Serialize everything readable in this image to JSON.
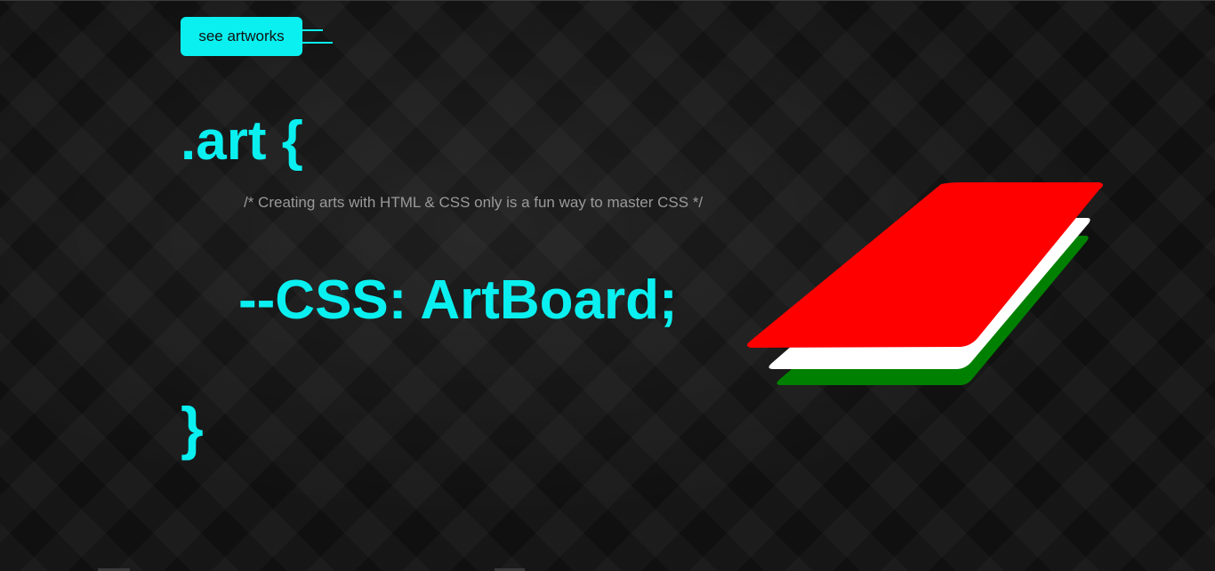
{
  "button": {
    "see_artworks_label": "see artworks"
  },
  "code": {
    "open_brace": ".art {",
    "comment": "/* Creating arts with HTML & CSS only is a fun way to master CSS */",
    "variable": "--CSS: ArtBoard;",
    "close_brace": "}"
  },
  "colors": {
    "accent": "#0af0f0",
    "comment": "#9a9a9a",
    "layer_top": "#ff0000",
    "layer_middle": "#ffffff",
    "layer_bottom": "#008000"
  }
}
